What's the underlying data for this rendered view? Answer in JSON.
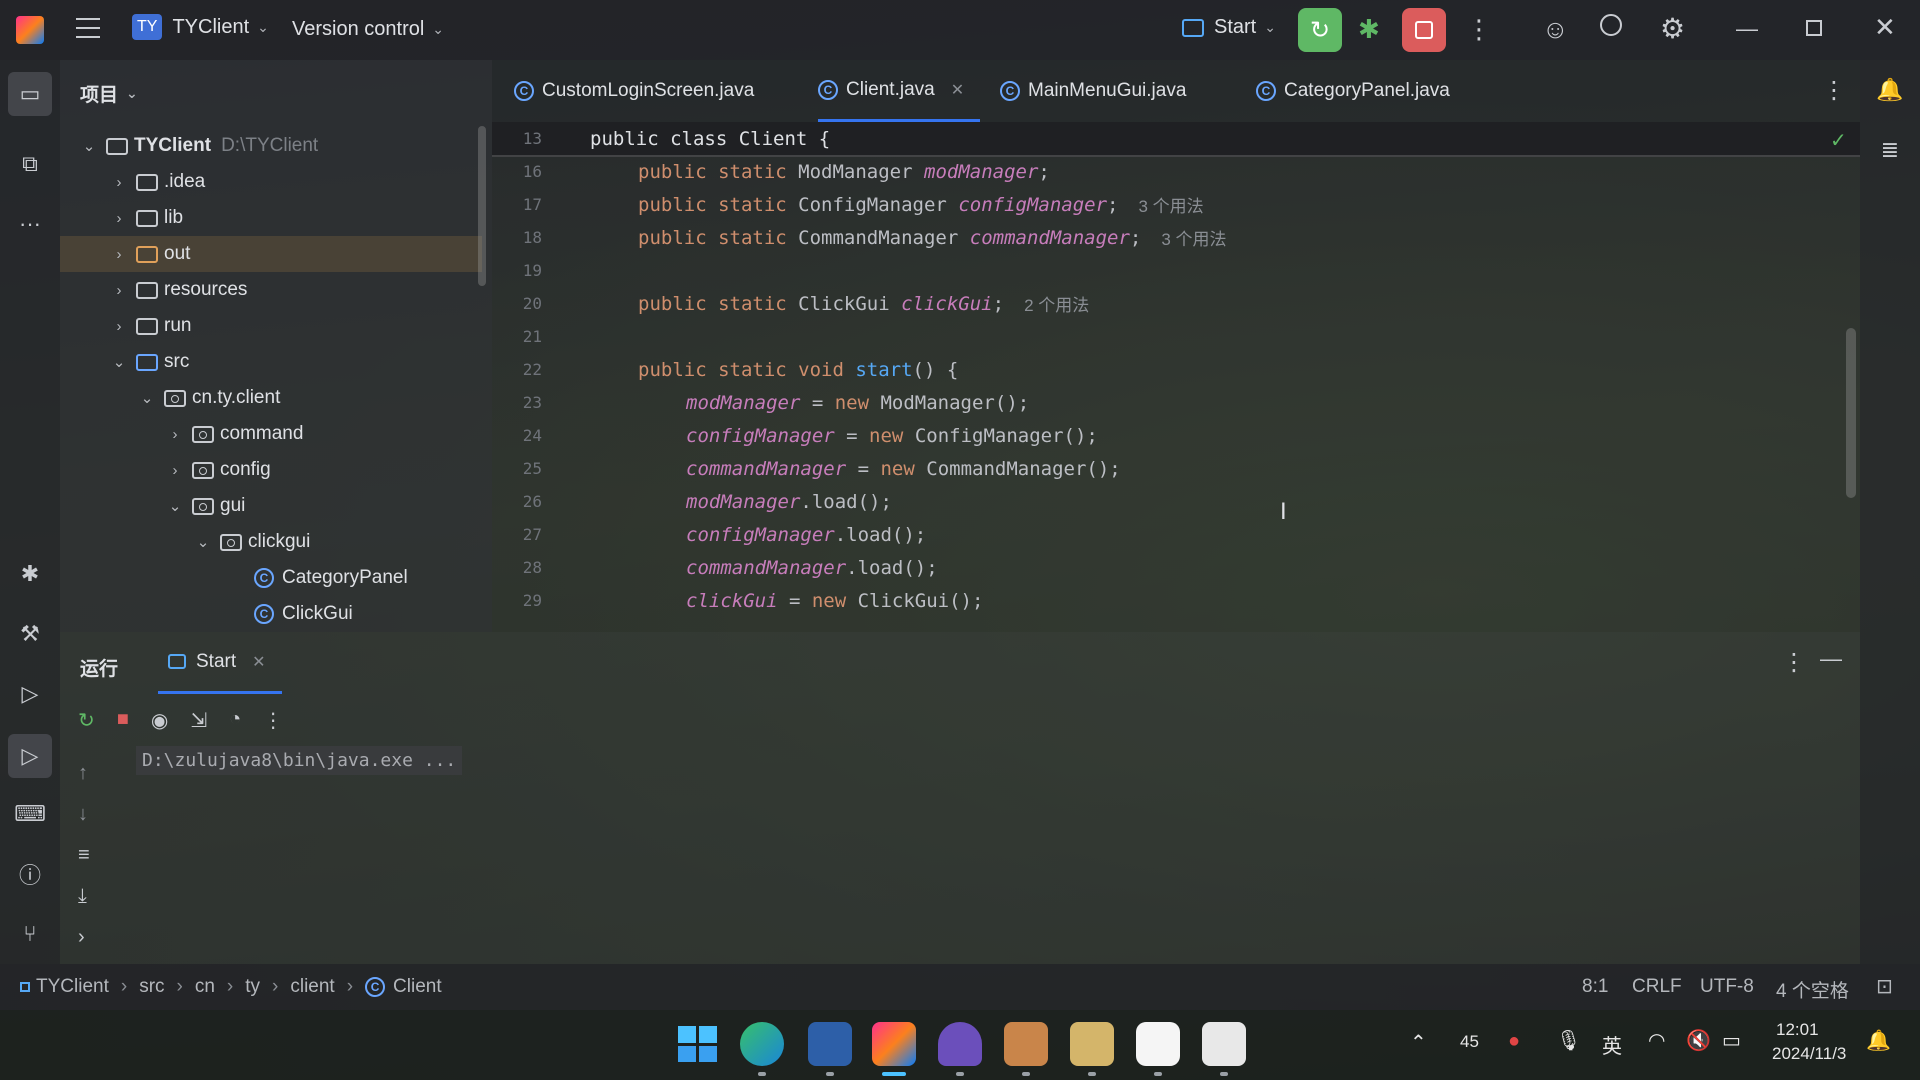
{
  "titlebar": {
    "project_badge": "TY",
    "project_name": "TYClient",
    "vcs": "Version control",
    "run_config": "Start"
  },
  "project_panel": {
    "title": "项目",
    "root": {
      "name": "TYClient",
      "path": "D:\\TYClient"
    },
    "items": [
      {
        "label": ".idea"
      },
      {
        "label": "lib"
      },
      {
        "label": "out"
      },
      {
        "label": "resources"
      },
      {
        "label": "run"
      },
      {
        "label": "src"
      },
      {
        "label": "cn.ty.client"
      },
      {
        "label": "command"
      },
      {
        "label": "config"
      },
      {
        "label": "gui"
      },
      {
        "label": "clickgui"
      },
      {
        "label": "CategoryPanel"
      },
      {
        "label": "ClickGui"
      }
    ]
  },
  "tabs": [
    {
      "label": "CustomLoginScreen.java"
    },
    {
      "label": "Client.java"
    },
    {
      "label": "MainMenuGui.java"
    },
    {
      "label": "CategoryPanel.java"
    }
  ],
  "editor": {
    "sticky": {
      "ln": "13",
      "text": "public class Client {"
    },
    "lines": [
      {
        "ln": "16",
        "kw": "public static ",
        "type": "ModManager ",
        "field": "modManager",
        "end": ";",
        "hint": ""
      },
      {
        "ln": "17",
        "kw": "public static ",
        "type": "ConfigManager ",
        "field": "configManager",
        "end": ";",
        "hint": "3 个用法"
      },
      {
        "ln": "18",
        "kw": "public static ",
        "type": "CommandManager ",
        "field": "commandManager",
        "end": ";",
        "hint": "3 个用法"
      },
      {
        "ln": "19"
      },
      {
        "ln": "20",
        "kw": "public static ",
        "type": "ClickGui ",
        "field": "clickGui",
        "end": ";",
        "hint": "2 个用法"
      },
      {
        "ln": "21"
      },
      {
        "ln": "22",
        "kw": "public static void ",
        "fn": "start",
        "end": "() {"
      },
      {
        "ln": "23",
        "field": "modManager",
        "mid": " = ",
        "kw2": "new ",
        "end": "ModManager();"
      },
      {
        "ln": "24",
        "field": "configManager",
        "mid": " = ",
        "kw2": "new ",
        "end": "ConfigManager();"
      },
      {
        "ln": "25",
        "field": "commandManager",
        "mid": " = ",
        "kw2": "new ",
        "end": "CommandManager();"
      },
      {
        "ln": "26",
        "field": "modManager",
        "end": ".load();"
      },
      {
        "ln": "27",
        "field": "configManager",
        "end": ".load();"
      },
      {
        "ln": "28",
        "field": "commandManager",
        "end": ".load();"
      },
      {
        "ln": "29",
        "field": "clickGui",
        "mid": " = ",
        "kw2": "new ",
        "end": "ClickGui();"
      }
    ]
  },
  "run_panel": {
    "title": "运行",
    "tab": "Start",
    "console_line": "D:\\zulujava8\\bin\\java.exe ..."
  },
  "statusbar": {
    "crumbs": [
      "TYClient",
      "src",
      "cn",
      "ty",
      "client",
      "Client"
    ],
    "position": "8:1",
    "line_sep": "CRLF",
    "encoding": "UTF-8",
    "indent": "4 个空格"
  },
  "taskbar": {
    "tray_num": "45",
    "ime": "英",
    "time": "12:01",
    "date": "2024/11/3"
  },
  "colors": {
    "accent": "#3574f0",
    "run_green": "#5fb865",
    "stop_red": "#db5c5c"
  }
}
